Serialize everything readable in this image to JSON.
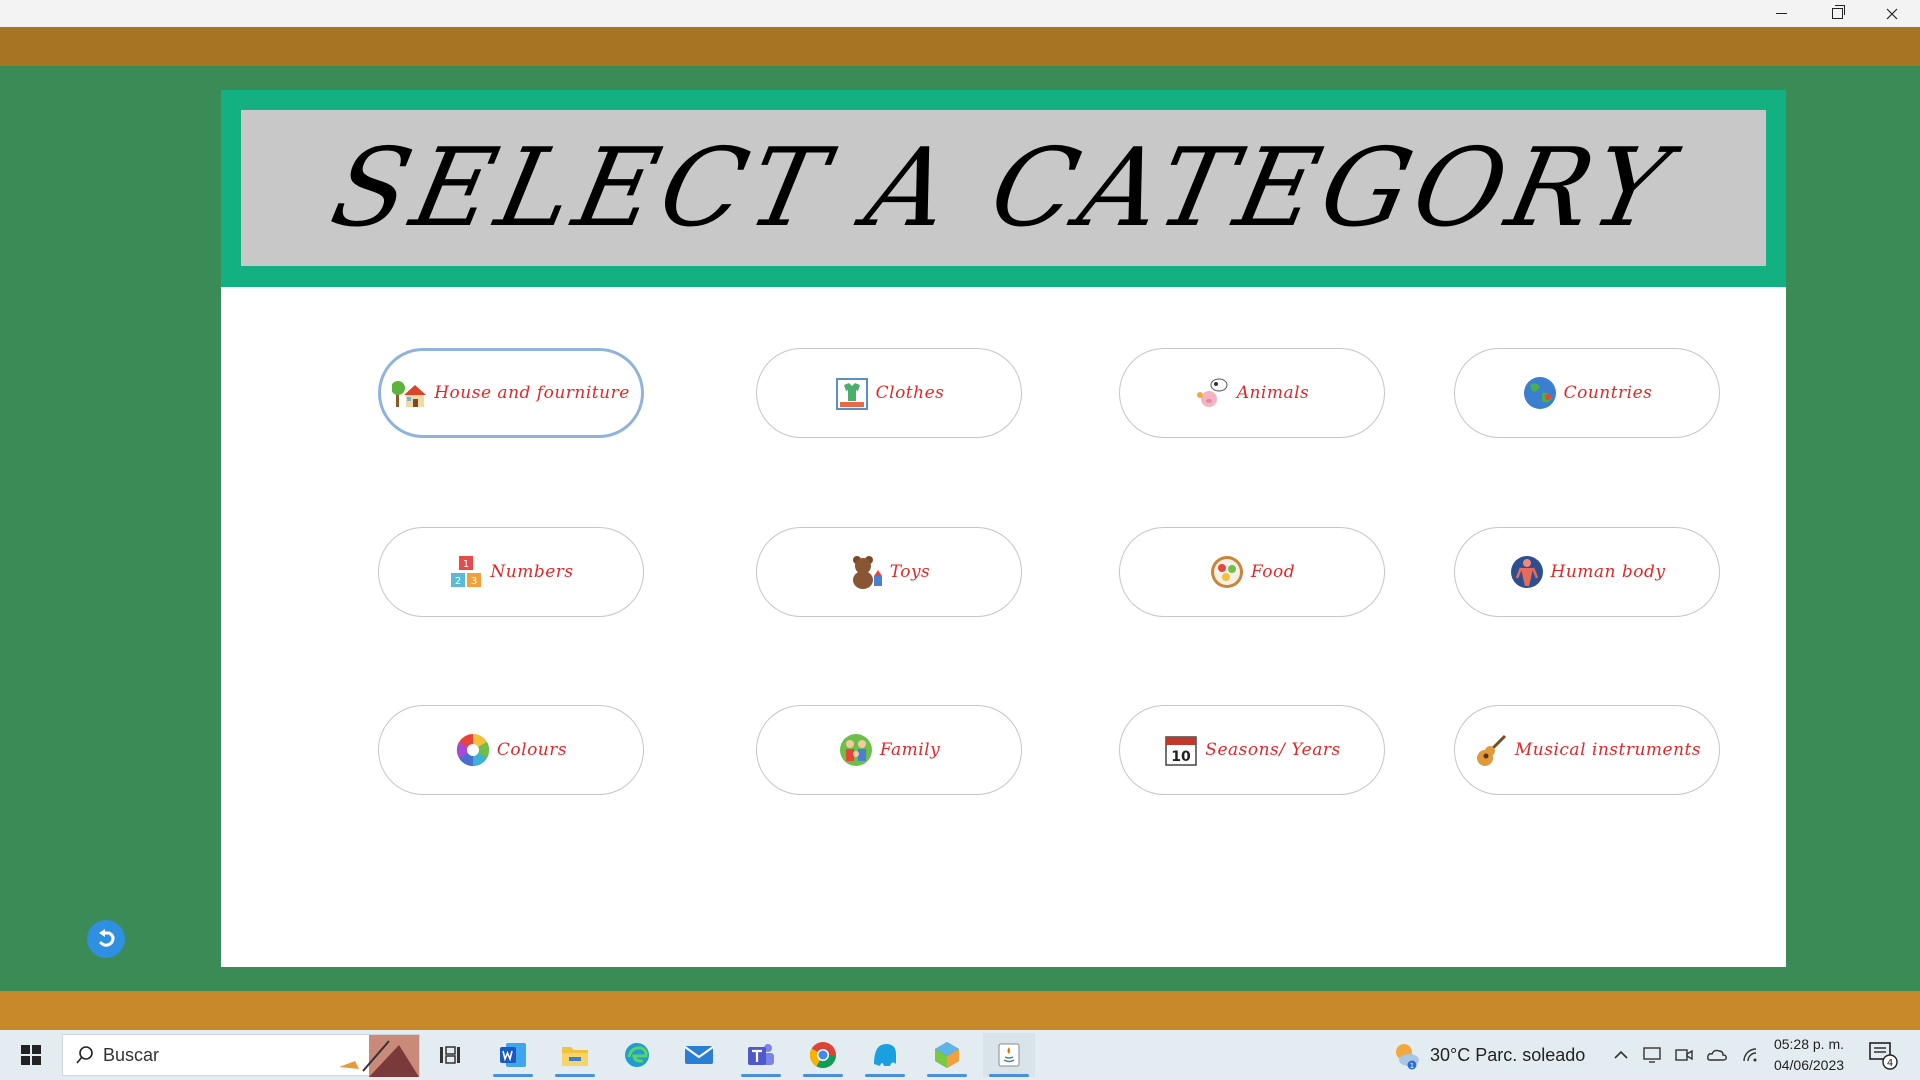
{
  "header": {
    "title": "SELECT A CATEGORY"
  },
  "categories": [
    {
      "label": "House and fourniture",
      "icon": "house-tree-icon"
    },
    {
      "label": "Clothes",
      "icon": "clothes-icon"
    },
    {
      "label": "Animals",
      "icon": "animals-icon"
    },
    {
      "label": "Countries",
      "icon": "globe-icon"
    },
    {
      "label": "Numbers",
      "icon": "number-blocks-icon"
    },
    {
      "label": "Toys",
      "icon": "teddy-bear-icon"
    },
    {
      "label": "Food",
      "icon": "food-plate-icon"
    },
    {
      "label": "Human body",
      "icon": "human-body-icon"
    },
    {
      "label": "Colours",
      "icon": "color-wheel-icon"
    },
    {
      "label": "Family",
      "icon": "family-icon"
    },
    {
      "label": "Seasons/ Years",
      "icon": "calendar-icon"
    },
    {
      "label": "Musical instruments",
      "icon": "guitar-icon"
    }
  ],
  "calendar_day": "10",
  "number_blocks": [
    "1",
    "2",
    "3"
  ],
  "taskbar": {
    "search_placeholder": "Buscar",
    "weather": "30°C  Parc. soleado",
    "time": "05:28 p. m.",
    "date": "04/06/2023",
    "notifications": "4",
    "weather_badge": "1"
  },
  "colors": {
    "background": "#3a8b56",
    "header_frame": "#13b082",
    "header_inner": "#c8c8c8",
    "label": "#e12727",
    "top_band": "#a67522",
    "bottom_band": "#c8892a"
  }
}
